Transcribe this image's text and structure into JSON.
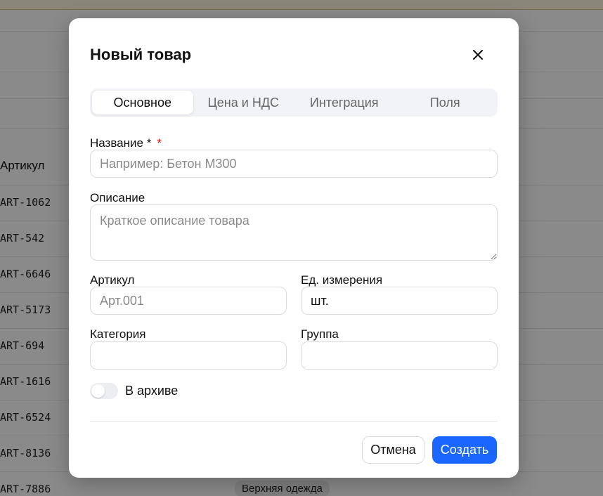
{
  "background": {
    "table_header": "Артикул",
    "rows": [
      "ART-1062",
      "ART-542",
      "ART-6646",
      "ART-5173",
      "ART-694",
      "ART-1616",
      "ART-6524",
      "ART-8136",
      "ART-7886"
    ],
    "badge": "Верхняя одежда"
  },
  "modal": {
    "title": "Новый товар",
    "close_icon": "close-icon",
    "tabs": [
      {
        "label": "Основное",
        "active": true
      },
      {
        "label": "Цена и НДС",
        "active": false
      },
      {
        "label": "Интеграция",
        "active": false
      },
      {
        "label": "Поля",
        "active": false
      }
    ],
    "fields": {
      "name": {
        "label": "Название *",
        "required_mark": "*",
        "value": "",
        "placeholder": "Например: Бетон М300"
      },
      "description": {
        "label": "Описание",
        "value": "",
        "placeholder": "Краткое описание товара"
      },
      "sku": {
        "label": "Артикул",
        "value": "",
        "placeholder": "Арт.001"
      },
      "unit": {
        "label": "Ед. измерения",
        "value": "шт.",
        "placeholder": ""
      },
      "category": {
        "label": "Категория",
        "value": "",
        "placeholder": ""
      },
      "group": {
        "label": "Группа",
        "value": "",
        "placeholder": ""
      }
    },
    "archive_toggle": {
      "label": "В архиве",
      "on": false
    },
    "buttons": {
      "cancel": "Отмена",
      "create": "Создать"
    },
    "colors": {
      "accent": "#1a66ff",
      "required": "#e00000"
    }
  }
}
